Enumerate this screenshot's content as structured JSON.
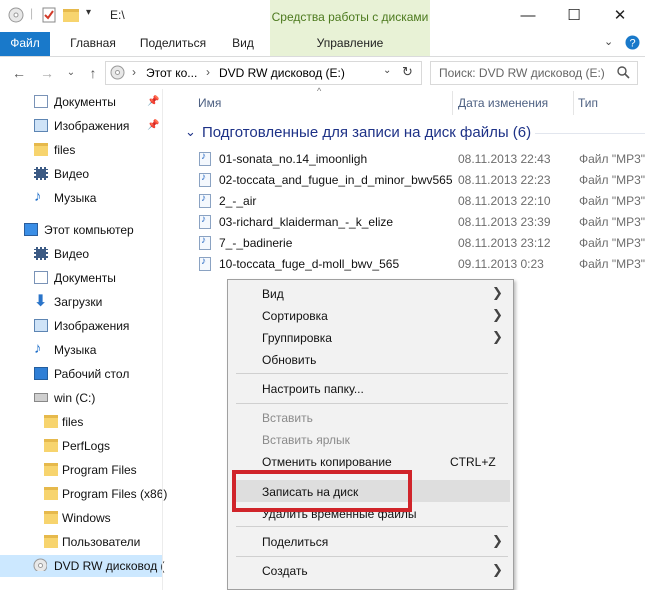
{
  "window": {
    "path": "E:\\",
    "ribbon_context_title": "Средства работы с дисками",
    "min_glyph": "—",
    "max_glyph": "☐",
    "close_glyph": "✕"
  },
  "tabs": {
    "file": "Файл",
    "home": "Главная",
    "share": "Поделиться",
    "view": "Вид",
    "manage": "Управление"
  },
  "address": {
    "back": "←",
    "forward": "→",
    "up": "↑",
    "crumb_pc": "Этот ко...",
    "crumb_drive": "DVD RW дисковод (E:)",
    "refresh": "↻",
    "search_placeholder": "Поиск: DVD RW дисковод (E:)"
  },
  "sidebar": {
    "items": [
      {
        "label": "Документы",
        "icon": "documents-icon"
      },
      {
        "label": "Изображения",
        "icon": "pictures-icon"
      },
      {
        "label": "files",
        "icon": "folder-icon"
      },
      {
        "label": "Видео",
        "icon": "video-icon"
      },
      {
        "label": "Музыка",
        "icon": "music-icon"
      },
      {
        "label": "Этот компьютер",
        "icon": "computer-icon"
      },
      {
        "label": "Видео",
        "icon": "video-icon"
      },
      {
        "label": "Документы",
        "icon": "documents-icon"
      },
      {
        "label": "Загрузки",
        "icon": "downloads-icon"
      },
      {
        "label": "Изображения",
        "icon": "pictures-icon"
      },
      {
        "label": "Музыка",
        "icon": "music-icon"
      },
      {
        "label": "Рабочий стол",
        "icon": "desktop-icon"
      },
      {
        "label": "win (C:)",
        "icon": "drive-icon"
      },
      {
        "label": "files",
        "icon": "folder-icon"
      },
      {
        "label": "PerfLogs",
        "icon": "folder-icon"
      },
      {
        "label": "Program Files",
        "icon": "folder-icon"
      },
      {
        "label": "Program Files (x86)",
        "icon": "folder-icon"
      },
      {
        "label": "Windows",
        "icon": "folder-icon"
      },
      {
        "label": "Пользователи",
        "icon": "folder-icon"
      },
      {
        "label": "DVD RW дисковод (",
        "icon": "dvd-drive-icon"
      }
    ]
  },
  "columns": {
    "name": "Имя",
    "date": "Дата изменения",
    "type": "Тип"
  },
  "group": {
    "title": "Подготовленные для записи на диск файлы (6)"
  },
  "files": [
    {
      "name": "01-sonata_no.14_imoonligh",
      "date": "08.11.2013 22:43",
      "type": "Файл \"MP3\""
    },
    {
      "name": "02-toccata_and_fugue_in_d_minor_bwv565",
      "date": "08.11.2013 22:23",
      "type": "Файл \"MP3\""
    },
    {
      "name": "2_-_air",
      "date": "08.11.2013 22:10",
      "type": "Файл \"MP3\""
    },
    {
      "name": "03-richard_klaiderman_-_k_elize",
      "date": "08.11.2013 23:39",
      "type": "Файл \"MP3\""
    },
    {
      "name": "7_-_badinerie",
      "date": "08.11.2013 23:12",
      "type": "Файл \"MP3\""
    },
    {
      "name": "10-toccata_fuge_d-moll_bwv_565",
      "date": "09.11.2013 0:23",
      "type": "Файл \"MP3\""
    }
  ],
  "context_menu": {
    "view": "Вид",
    "sort": "Сортировка",
    "group": "Группировка",
    "refresh": "Обновить",
    "customize": "Настроить папку...",
    "paste": "Вставить",
    "paste_shortcut": "Вставить ярлык",
    "undo_copy": "Отменить копирование",
    "undo_shortcut": "CTRL+Z",
    "burn": "Записать на диск",
    "delete_temp": "Удалить временные файлы",
    "share": "Поделиться",
    "new": "Создать",
    "submenu_arrow": "❯"
  }
}
